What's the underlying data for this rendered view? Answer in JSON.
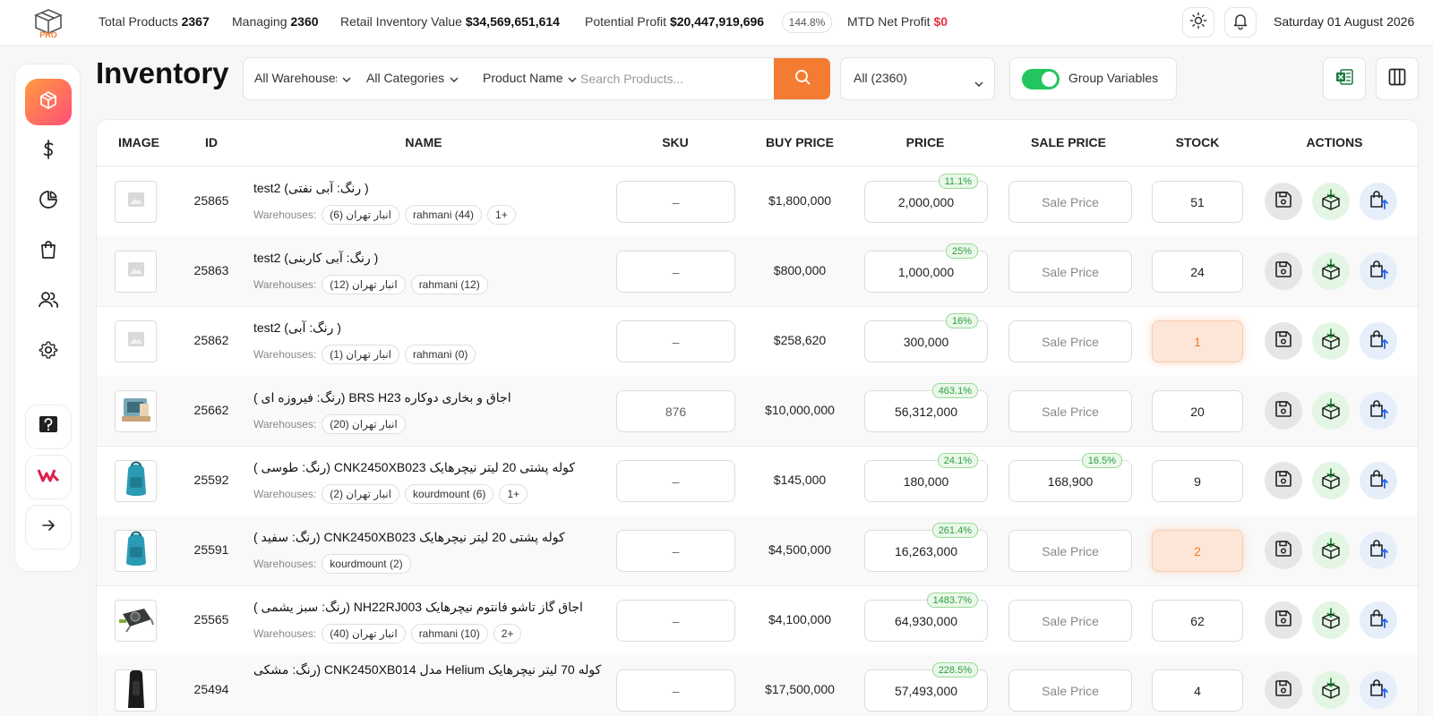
{
  "header": {
    "stats": [
      {
        "label": "Total Products",
        "value": "2367"
      },
      {
        "label": "Managing",
        "value": "2360"
      },
      {
        "label": "Retail Inventory Value",
        "value": "$34,569,651,614"
      },
      {
        "label": "Potential Profit",
        "value": "$20,447,919,696"
      },
      {
        "label": "MTD Net Profit",
        "value": "$0"
      }
    ],
    "profit_percent": "144.8%",
    "date": "Saturday 01 August 2026",
    "logo_text": "PRO"
  },
  "page": {
    "title": "Inventory"
  },
  "filters": {
    "warehouse": "All Warehouses",
    "categories": "All Categories",
    "search_field": "Product Name",
    "search_placeholder": "Search Products...",
    "status": "All (2360)",
    "group_label": "Group Variables",
    "group_enabled": true
  },
  "table": {
    "columns": [
      "IMAGE",
      "ID",
      "NAME",
      "SKU",
      "BUY PRICE",
      "PRICE",
      "SALE PRICE",
      "STOCK",
      "ACTIONS"
    ],
    "warehouses_label": "Warehouses:",
    "sale_placeholder": "Sale Price",
    "rows": [
      {
        "id": "25865",
        "name": "test2 (رنگ: آبی نفتی )",
        "warehouses": [
          "انبار تهران (6)",
          "rahmani (44)",
          "1+"
        ],
        "sku": "–",
        "buy": "$1,800,000",
        "price": "2,000,000",
        "price_pct": "11.1%",
        "sale": "",
        "sale_pct": "",
        "stock": "51",
        "low": false,
        "thumb": "placeholder"
      },
      {
        "id": "25863",
        "name": "test2 (رنگ: آبی کاربنی )",
        "warehouses": [
          "انبار تهران (12)",
          "rahmani (12)"
        ],
        "sku": "–",
        "buy": "$800,000",
        "price": "1,000,000",
        "price_pct": "25%",
        "sale": "",
        "sale_pct": "",
        "stock": "24",
        "low": false,
        "thumb": "placeholder"
      },
      {
        "id": "25862",
        "name": "test2 (رنگ: آبی )",
        "warehouses": [
          "انبار تهران (1)",
          "rahmani (0)"
        ],
        "sku": "–",
        "buy": "$258,620",
        "price": "300,000",
        "price_pct": "16%",
        "sale": "",
        "sale_pct": "",
        "stock": "1",
        "low": true,
        "thumb": "placeholder"
      },
      {
        "id": "25662",
        "name": "اجاق و بخاری دوکاره BRS H23 (رنگ: فیروزه ای )",
        "warehouses": [
          "انبار تهران (20)"
        ],
        "sku": "876",
        "buy": "$10,000,000",
        "price": "56,312,000",
        "price_pct": "463.1%",
        "sale": "",
        "sale_pct": "",
        "stock": "20",
        "low": false,
        "thumb": "stove"
      },
      {
        "id": "25592",
        "name": "کوله پشتی 20 لیتر نیچرهایک CNK2450XB023 (رنگ: طوسی )",
        "warehouses": [
          "انبار تهران (2)",
          "kourdmount (6)",
          "1+"
        ],
        "sku": "–",
        "buy": "$145,000",
        "price": "180,000",
        "price_pct": "24.1%",
        "sale": "168,900",
        "sale_pct": "16.5%",
        "stock": "9",
        "low": false,
        "thumb": "backpack"
      },
      {
        "id": "25591",
        "name": "کوله پشتی 20 لیتر نیچرهایک CNK2450XB023 (رنگ: سفید )",
        "warehouses": [
          "kourdmount (2)"
        ],
        "sku": "–",
        "buy": "$4,500,000",
        "price": "16,263,000",
        "price_pct": "261.4%",
        "sale": "",
        "sale_pct": "",
        "stock": "2",
        "low": true,
        "thumb": "backpack"
      },
      {
        "id": "25565",
        "name": "اجاق گاز تاشو فانتوم نیچرهایک NH22RJ003 (رنگ: سبز یشمی )",
        "warehouses": [
          "انبار تهران (40)",
          "rahmani (10)",
          "2+"
        ],
        "sku": "–",
        "buy": "$4,100,000",
        "price": "64,930,000",
        "price_pct": "1483.7%",
        "sale": "",
        "sale_pct": "",
        "stock": "62",
        "low": false,
        "thumb": "burner"
      },
      {
        "id": "25494",
        "name": "کوله 70 لیتر نیچرهایک Helium مدل CNK2450XB014 (رنگ: مشکی",
        "warehouses": [],
        "sku": "–",
        "buy": "$17,500,000",
        "price": "57,493,000",
        "price_pct": "228.5%",
        "sale": "",
        "sale_pct": "",
        "stock": "4",
        "low": false,
        "thumb": "black-pack"
      }
    ]
  },
  "colors": {
    "accent": "#f47c32",
    "toggle": "#22c55e",
    "negative": "#e8323c",
    "badge_green": "#2f9e44"
  }
}
